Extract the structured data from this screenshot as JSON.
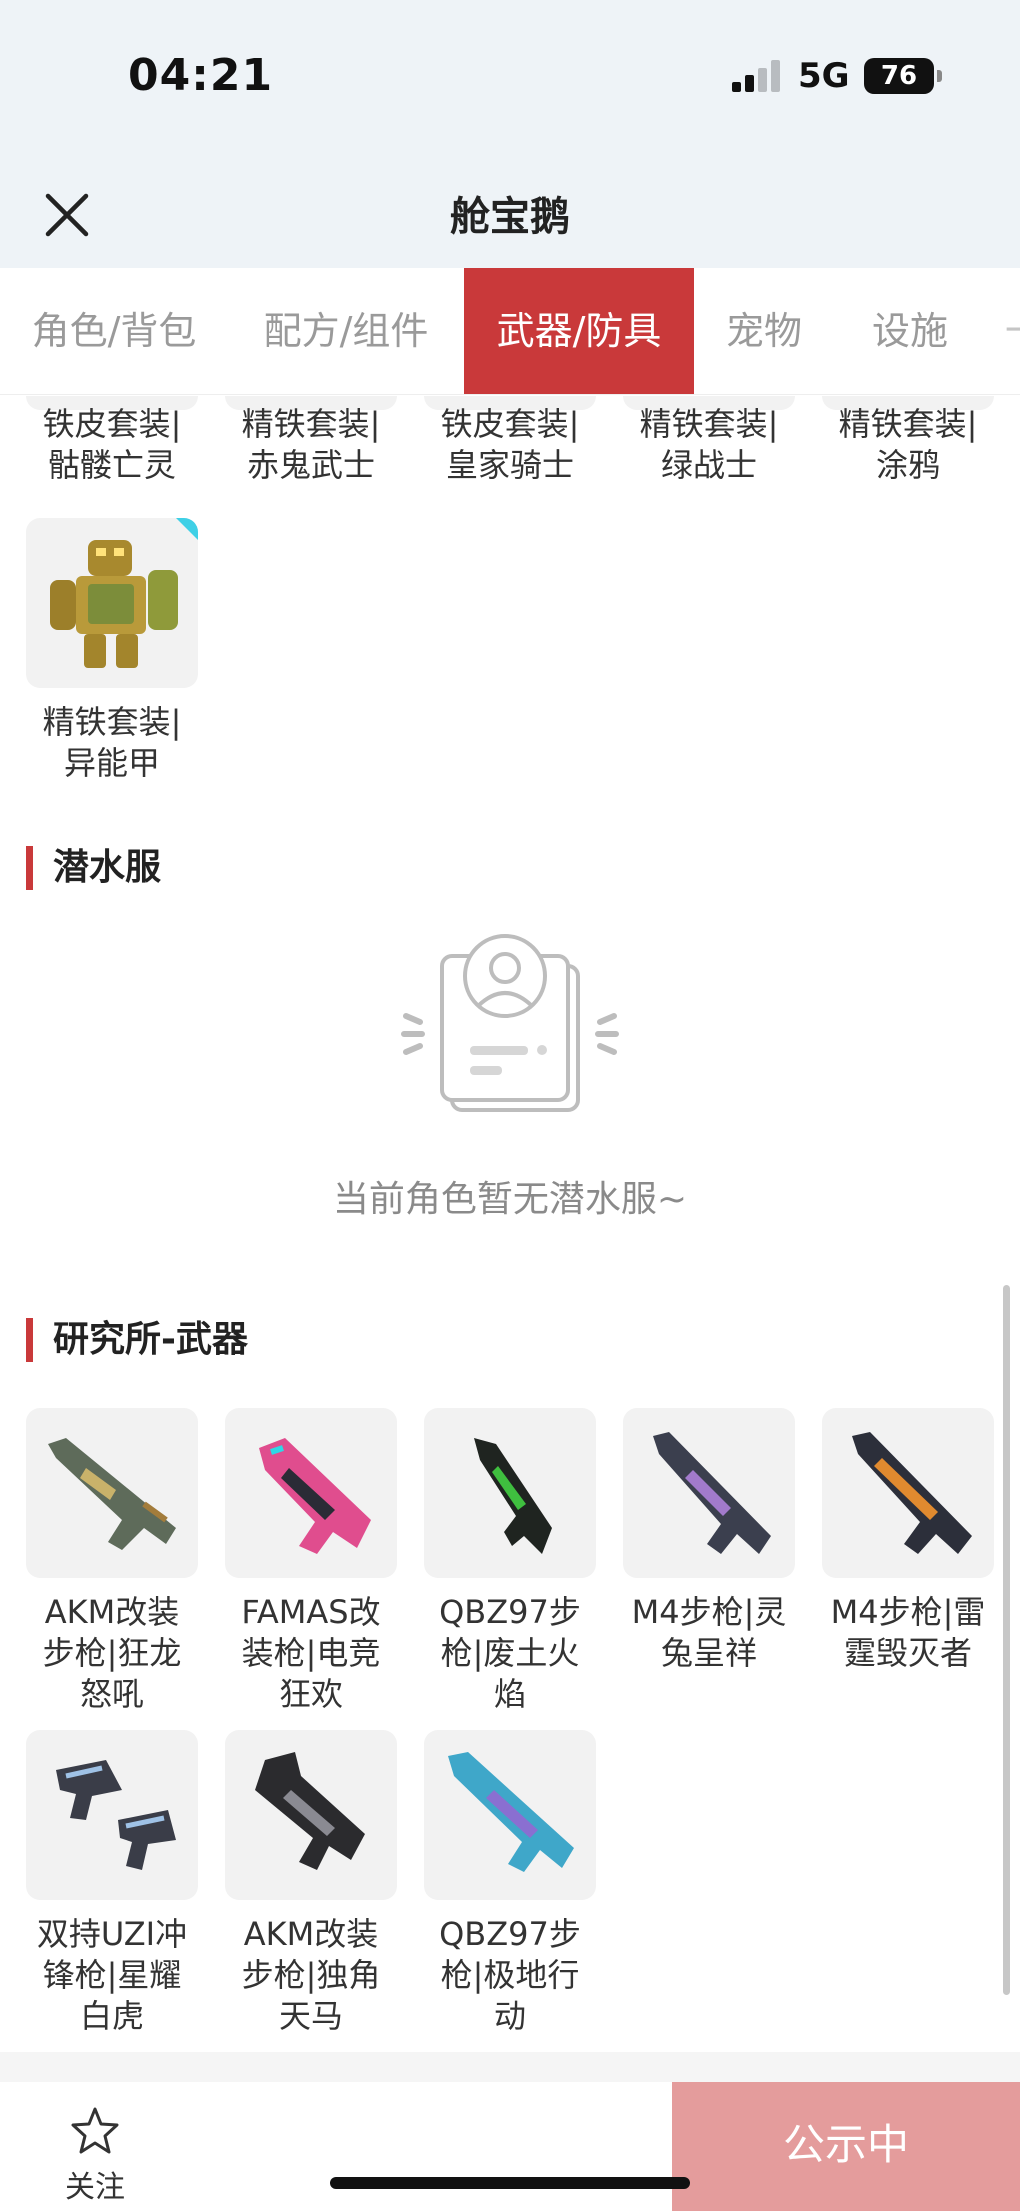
{
  "status_bar": {
    "time": "04:21",
    "network": "5G",
    "battery": "76"
  },
  "nav": {
    "title": "舱宝鹅",
    "close_icon": "close-icon"
  },
  "tabs": [
    {
      "label": "角色/背包",
      "active": false
    },
    {
      "label": "配方/组件",
      "active": false
    },
    {
      "label": "武器/防具",
      "active": true
    },
    {
      "label": "宠物",
      "active": false
    },
    {
      "label": "设施",
      "active": false
    }
  ],
  "armor_partial_row": [
    "铁皮套装|\n骷髅亡灵",
    "精铁套装|\n赤鬼武士",
    "铁皮套装|\n皇家骑士",
    "精铁套装|\n绿战士",
    "精铁套装|\n涂鸦"
  ],
  "armor_items": [
    {
      "name": "精铁套装|\n异能甲",
      "icon": "golden-robot-armor-icon",
      "tag_color": "#3fd0e6"
    }
  ],
  "diving_suit": {
    "title": "潜水服",
    "empty_icon": "empty-profile-icon",
    "empty_text": "当前角色暂无潜水服~"
  },
  "lab_weapons": {
    "title": "研究所-武器",
    "items": [
      {
        "name": "AKM改装\n步枪|狂龙\n怒吼",
        "icon": "rifle-icon"
      },
      {
        "name": "FAMAS改\n装枪|电竞\n狂欢",
        "icon": "rifle-icon"
      },
      {
        "name": "QBZ97步\n枪|废土火\n焰",
        "icon": "rifle-icon"
      },
      {
        "name": "M4步枪|灵\n兔呈祥",
        "icon": "rifle-icon"
      },
      {
        "name": "M4步枪|雷\n霆毁灭者",
        "icon": "rifle-icon"
      },
      {
        "name": "双持UZI冲\n锋枪|星耀\n白虎",
        "icon": "dual-smg-icon"
      },
      {
        "name": "AKM改装\n步枪|独角\n天马",
        "icon": "rifle-icon"
      },
      {
        "name": "QBZ97步\n枪|极地行\n动",
        "icon": "rifle-icon"
      }
    ]
  },
  "bottom_bar": {
    "follow_label": "关注",
    "star_icon": "star-icon",
    "public_label": "公示中"
  },
  "colors": {
    "accent": "#c9393a",
    "public_button": "#e49c9c",
    "header_bg": "#eef3f7"
  }
}
